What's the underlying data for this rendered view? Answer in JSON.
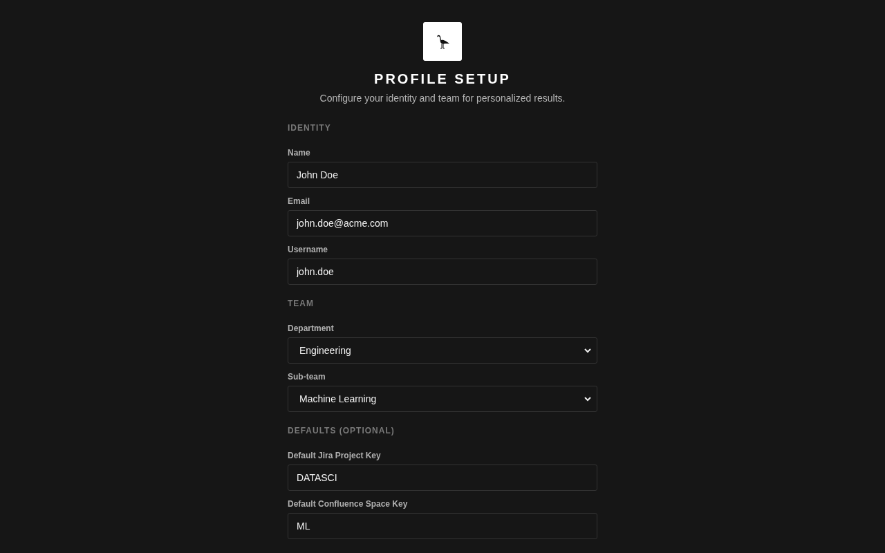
{
  "header": {
    "title": "PROFILE SETUP",
    "subtitle": "Configure your identity and team for personalized results."
  },
  "sections": [
    {
      "title": "IDENTITY",
      "fields": [
        {
          "label": "Name",
          "kind": "text",
          "value": "John Doe"
        },
        {
          "label": "Email",
          "kind": "text",
          "value": "john.doe@acme.com"
        },
        {
          "label": "Username",
          "kind": "text",
          "value": "john.doe"
        }
      ]
    },
    {
      "title": "TEAM",
      "fields": [
        {
          "label": "Department",
          "kind": "select",
          "value": "Engineering"
        },
        {
          "label": "Sub-team",
          "kind": "select",
          "value": "Machine Learning"
        }
      ]
    },
    {
      "title": "DEFAULTS (OPTIONAL)",
      "fields": [
        {
          "label": "Default Jira Project Key",
          "kind": "text",
          "value": "DATASCI"
        },
        {
          "label": "Default Confluence Space Key",
          "kind": "text",
          "value": "ML"
        }
      ]
    }
  ]
}
